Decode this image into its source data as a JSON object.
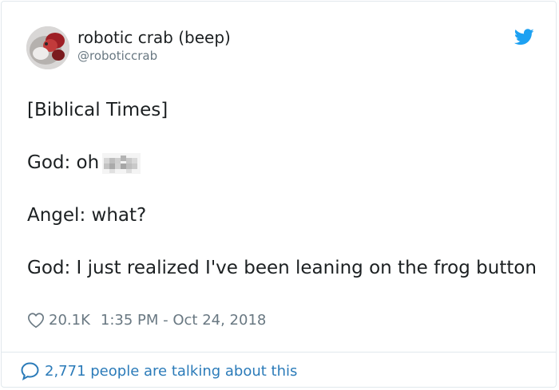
{
  "author": {
    "display_name": "robotic crab (beep)",
    "handle": "@roboticcrab",
    "avatar_icon": "crab-avatar-photo"
  },
  "tweet": {
    "lines": [
      "[Biblical Times]",
      "God: oh",
      "Angel: what?",
      "God: I just realized I've been leaning on the frog button"
    ],
    "censored_word_icon": "pixelated-censor-blur"
  },
  "meta": {
    "likes": "20.1K",
    "timestamp": "1:35 PM - Oct 24, 2018"
  },
  "footer": {
    "talking_text": "2,771 people are talking about this"
  },
  "colors": {
    "twitter_blue": "#1da1f2",
    "link_blue": "#2b7bb9",
    "text": "#1c2022",
    "muted": "#697882",
    "border": "#e1e8ed"
  }
}
